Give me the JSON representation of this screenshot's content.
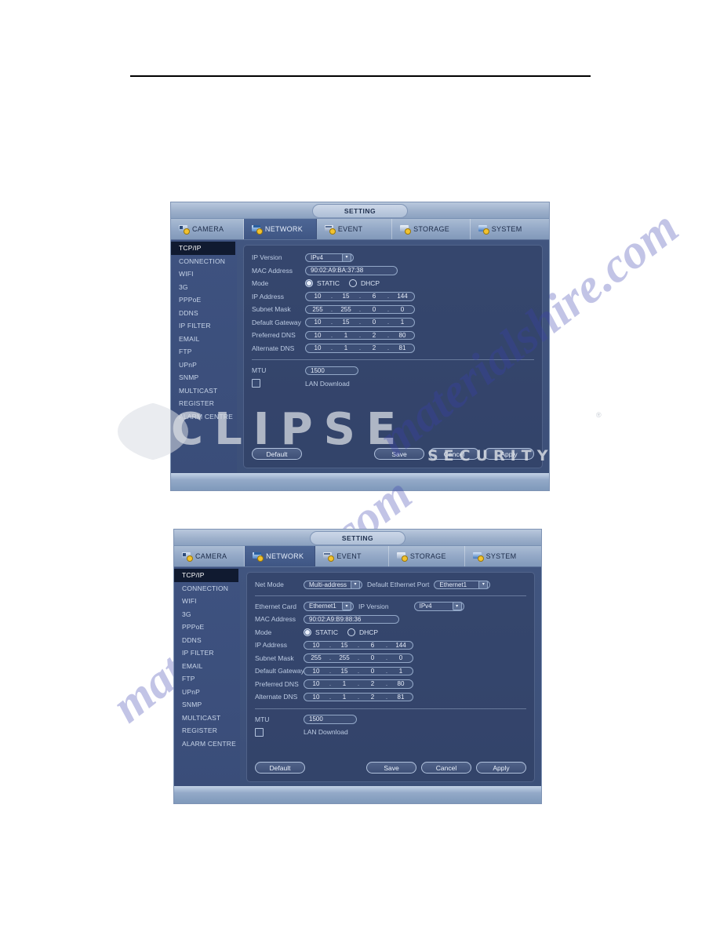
{
  "document": {
    "watermark_diagonal": "materialshire.com",
    "brand_watermark": "CLIPSE",
    "brand_watermark_sub": "SECURITY",
    "brand_registered": "®"
  },
  "dialog1": {
    "title": "SETTING",
    "tabs": [
      {
        "label": "CAMERA",
        "icon": "camera-icon",
        "active": false
      },
      {
        "label": "NETWORK",
        "icon": "network-icon",
        "active": true
      },
      {
        "label": "EVENT",
        "icon": "event-icon",
        "active": false
      },
      {
        "label": "STORAGE",
        "icon": "storage-icon",
        "active": false
      },
      {
        "label": "SYSTEM",
        "icon": "system-icon",
        "active": false
      }
    ],
    "sidebar": [
      {
        "label": "TCP/IP",
        "active": true
      },
      {
        "label": "CONNECTION",
        "active": false
      },
      {
        "label": "WIFI",
        "active": false
      },
      {
        "label": "3G",
        "active": false
      },
      {
        "label": "PPPoE",
        "active": false
      },
      {
        "label": "DDNS",
        "active": false
      },
      {
        "label": "IP FILTER",
        "active": false
      },
      {
        "label": "EMAIL",
        "active": false
      },
      {
        "label": "FTP",
        "active": false
      },
      {
        "label": "UPnP",
        "active": false
      },
      {
        "label": "SNMP",
        "active": false
      },
      {
        "label": "MULTICAST",
        "active": false
      },
      {
        "label": "REGISTER",
        "active": false
      },
      {
        "label": "ALARM CENTRE",
        "active": false
      }
    ],
    "form": {
      "ip_version_label": "IP Version",
      "ip_version_value": "IPv4",
      "mac_label": "MAC Address",
      "mac_value": "90:02:A9:BA:37:38",
      "mode_label": "Mode",
      "mode_static": "STATIC",
      "mode_dhcp": "DHCP",
      "mode_selected": "STATIC",
      "ip_address_label": "IP Address",
      "ip_address": [
        "10",
        "15",
        "6",
        "144"
      ],
      "subnet_label": "Subnet Mask",
      "subnet": [
        "255",
        "255",
        "0",
        "0"
      ],
      "gateway_label": "Default Gateway",
      "gateway": [
        "10",
        "15",
        "0",
        "1"
      ],
      "pref_dns_label": "Preferred DNS",
      "pref_dns": [
        "10",
        "1",
        "2",
        "80"
      ],
      "alt_dns_label": "Alternate DNS",
      "alt_dns": [
        "10",
        "1",
        "2",
        "81"
      ],
      "mtu_label": "MTU",
      "mtu_value": "1500",
      "lan_download_label": "LAN Download",
      "lan_download_checked": false
    },
    "buttons": {
      "default": "Default",
      "save": "Save",
      "cancel": "Cancel",
      "apply": "Apply"
    }
  },
  "dialog2": {
    "title": "SETTING",
    "tabs": [
      {
        "label": "CAMERA",
        "icon": "camera-icon",
        "active": false
      },
      {
        "label": "NETWORK",
        "icon": "network-icon",
        "active": true
      },
      {
        "label": "EVENT",
        "icon": "event-icon",
        "active": false
      },
      {
        "label": "STORAGE",
        "icon": "storage-icon",
        "active": false
      },
      {
        "label": "SYSTEM",
        "icon": "system-icon",
        "active": false
      }
    ],
    "sidebar": [
      {
        "label": "TCP/IP",
        "active": true
      },
      {
        "label": "CONNECTION",
        "active": false
      },
      {
        "label": "WIFI",
        "active": false
      },
      {
        "label": "3G",
        "active": false
      },
      {
        "label": "PPPoE",
        "active": false
      },
      {
        "label": "DDNS",
        "active": false
      },
      {
        "label": "IP FILTER",
        "active": false
      },
      {
        "label": "EMAIL",
        "active": false
      },
      {
        "label": "FTP",
        "active": false
      },
      {
        "label": "UPnP",
        "active": false
      },
      {
        "label": "SNMP",
        "active": false
      },
      {
        "label": "MULTICAST",
        "active": false
      },
      {
        "label": "REGISTER",
        "active": false
      },
      {
        "label": "ALARM CENTRE",
        "active": false
      }
    ],
    "form": {
      "net_mode_label": "Net Mode",
      "net_mode_value": "Multi-address",
      "default_eth_label": "Default Ethernet Port",
      "default_eth_value": "Ethernet1",
      "eth_card_label": "Ethernet Card",
      "eth_card_value": "Ethernet1",
      "ip_version_label": "IP Version",
      "ip_version_value": "IPv4",
      "mac_label": "MAC Address",
      "mac_value": "90:02:A9:B9:88:36",
      "mode_label": "Mode",
      "mode_static": "STATIC",
      "mode_dhcp": "DHCP",
      "mode_selected": "STATIC",
      "ip_address_label": "IP Address",
      "ip_address": [
        "10",
        "15",
        "6",
        "144"
      ],
      "subnet_label": "Subnet Mask",
      "subnet": [
        "255",
        "255",
        "0",
        "0"
      ],
      "gateway_label": "Default Gateway",
      "gateway": [
        "10",
        "15",
        "0",
        "1"
      ],
      "pref_dns_label": "Preferred DNS",
      "pref_dns": [
        "10",
        "1",
        "2",
        "80"
      ],
      "alt_dns_label": "Alternate DNS",
      "alt_dns": [
        "10",
        "1",
        "2",
        "81"
      ],
      "mtu_label": "MTU",
      "mtu_value": "1500",
      "lan_download_label": "LAN Download",
      "lan_download_checked": false
    },
    "buttons": {
      "default": "Default",
      "save": "Save",
      "cancel": "Cancel",
      "apply": "Apply"
    }
  }
}
